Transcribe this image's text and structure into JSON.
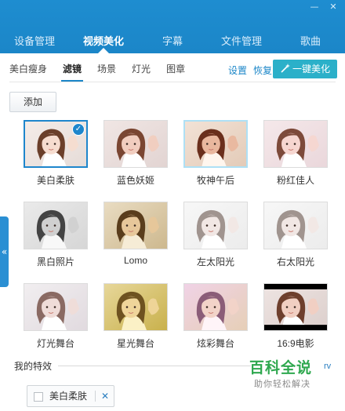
{
  "window": {
    "controls": [
      {
        "name": "minimize-button",
        "glyph": "—"
      },
      {
        "name": "close-button",
        "glyph": "✕"
      }
    ]
  },
  "main_tabs": [
    {
      "label": "设备管理",
      "active": false
    },
    {
      "label": "视频美化",
      "active": true
    },
    {
      "label": "字幕",
      "active": false
    },
    {
      "label": "文件管理",
      "active": false
    },
    {
      "label": "歌曲",
      "active": false
    }
  ],
  "sub_tabs": [
    {
      "label": "美白瘦身",
      "active": false
    },
    {
      "label": "滤镜",
      "active": true
    },
    {
      "label": "场景",
      "active": false
    },
    {
      "label": "灯光",
      "active": false
    },
    {
      "label": "图章",
      "active": false
    }
  ],
  "actions": {
    "settings": "设置",
    "restore": "恢复",
    "one_click": "一键美化",
    "one_click_icon": "magic-wand-icon",
    "add": "添加"
  },
  "filters": [
    {
      "label": "美白柔肤",
      "style": "soft",
      "selected": true
    },
    {
      "label": "蓝色妖姬",
      "style": "normal",
      "selected": false
    },
    {
      "label": "牧神午后",
      "style": "warm",
      "selected": false,
      "hover": true
    },
    {
      "label": "粉红佳人",
      "style": "pink",
      "selected": false
    },
    {
      "label": "黑白照片",
      "style": "bw",
      "selected": false
    },
    {
      "label": "Lomo",
      "style": "lomo",
      "selected": false
    },
    {
      "label": "左太阳光",
      "style": "light",
      "selected": false
    },
    {
      "label": "右太阳光",
      "style": "light",
      "selected": false
    },
    {
      "label": "灯光舞台",
      "style": "stage",
      "selected": false
    },
    {
      "label": "星光舞台",
      "style": "star",
      "selected": false
    },
    {
      "label": "炫彩舞台",
      "style": "color",
      "selected": false
    },
    {
      "label": "16:9电影",
      "style": "cinema",
      "selected": false
    }
  ],
  "collapse_glyph": "«",
  "my_effects": {
    "title": "我的特效",
    "chips": [
      {
        "label": "美白柔肤",
        "close_glyph": "✕"
      }
    ]
  },
  "watermark": {
    "title": "百科全说",
    "subtitle": "助你轻松解决",
    "mark": "rv"
  },
  "colors": {
    "header": "#1b86c8",
    "accent": "#1e86cc",
    "magic_button": "#2bb0c9",
    "watermark_green": "#2fa84f"
  }
}
